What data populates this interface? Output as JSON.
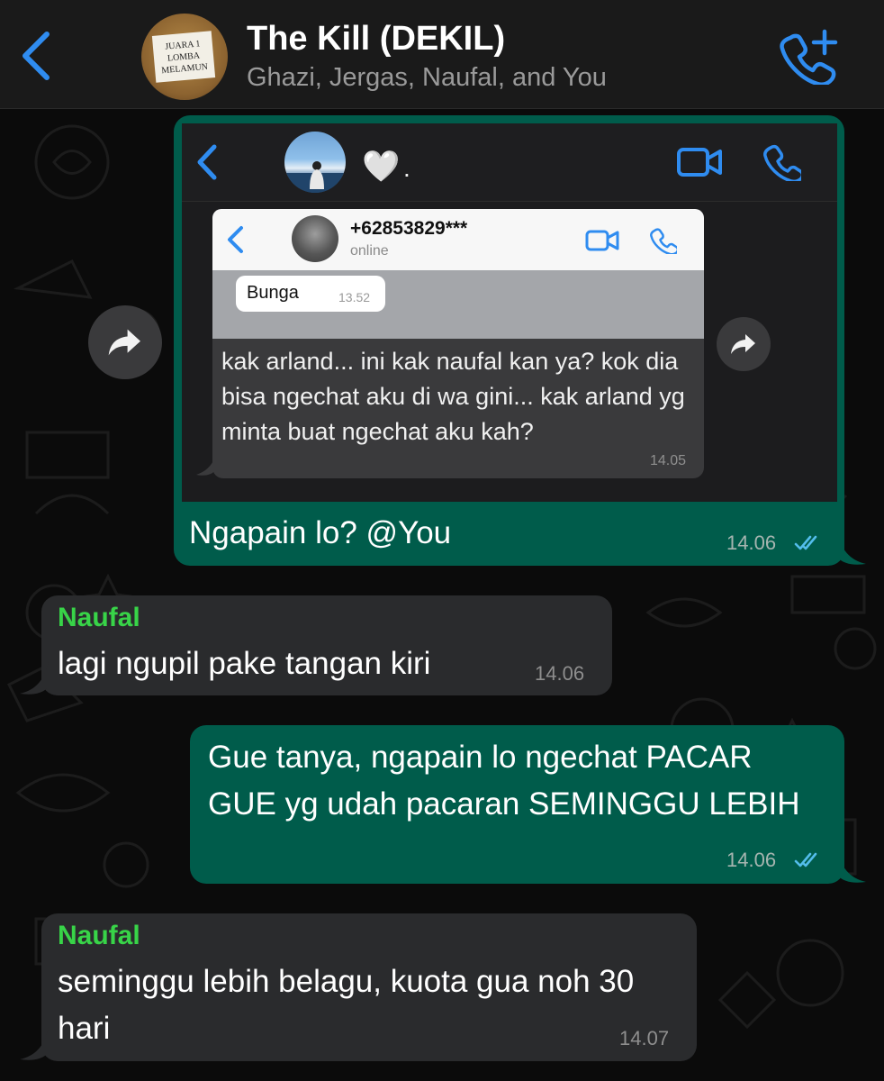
{
  "header": {
    "title": "The Kill (DEKIL)",
    "members": "Ghazi, Jergas, Naufal, and You",
    "avatar_sign": [
      "JUARA 1",
      "LOMBA",
      "MELAMUN"
    ]
  },
  "forwarded_screenshot": {
    "contact_heart": "🤍",
    "contact_dot": ".",
    "inner": {
      "contact_name": "+62853829***",
      "status": "online",
      "bubble_text": "Bunga",
      "bubble_time": "13.52"
    },
    "message_text": "kak arland... ini kak naufal kan ya? kok dia bisa ngechat aku di wa gini... kak arland yg minta buat ngechat aku kah?",
    "message_time": "14.05"
  },
  "messages": [
    {
      "direction": "outgoing",
      "text": "Ngapain lo? @You",
      "time": "14.06",
      "read": true
    },
    {
      "direction": "incoming",
      "sender": "Naufal",
      "text": "lagi ngupil pake tangan kiri",
      "time": "14.06"
    },
    {
      "direction": "outgoing",
      "text": "Gue tanya, ngapain lo ngechat PACAR GUE yg udah pacaran SEMINGGU LEBIH",
      "time": "14.06",
      "read": true
    },
    {
      "direction": "incoming",
      "sender": "Naufal",
      "text": "seminggu lebih belagu, kuota gua noh 30 hari",
      "time": "14.07"
    }
  ],
  "colors": {
    "accent_blue": "#2f8cf0",
    "outgoing_bubble": "#005c4b",
    "incoming_bubble": "#2a2b2d",
    "sender_name": "#38d448",
    "background": "#0b0b0b"
  },
  "icons": {
    "header": [
      "back-chevron-icon",
      "add-call-icon"
    ],
    "screenshot": [
      "back-chevron-icon",
      "video-call-icon",
      "phone-icon"
    ],
    "forward": "forward-arrow-icon",
    "read_receipt": "double-check-icon"
  }
}
